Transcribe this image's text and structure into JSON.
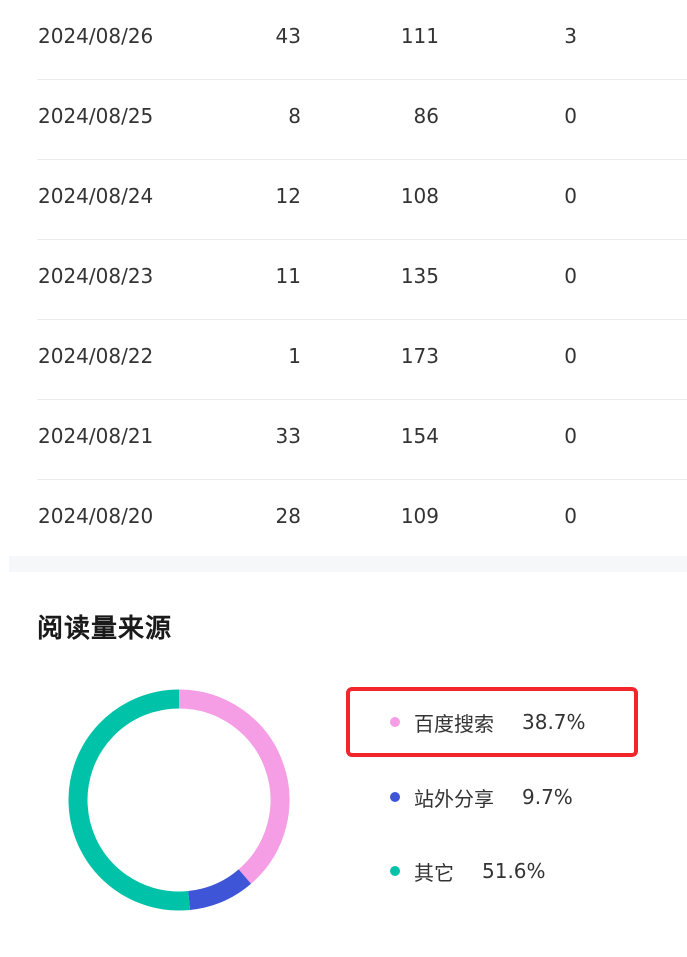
{
  "table": {
    "rows": [
      {
        "date": "2024/08/26",
        "a": "43",
        "b": "111",
        "c": "3"
      },
      {
        "date": "2024/08/25",
        "a": "8",
        "b": "86",
        "c": "0"
      },
      {
        "date": "2024/08/24",
        "a": "12",
        "b": "108",
        "c": "0"
      },
      {
        "date": "2024/08/23",
        "a": "11",
        "b": "135",
        "c": "0"
      },
      {
        "date": "2024/08/22",
        "a": "1",
        "b": "173",
        "c": "0"
      },
      {
        "date": "2024/08/21",
        "a": "33",
        "b": "154",
        "c": "0"
      },
      {
        "date": "2024/08/20",
        "a": "28",
        "b": "109",
        "c": "0"
      }
    ]
  },
  "sources": {
    "title": "阅读量来源",
    "items": [
      {
        "label": "百度搜索",
        "percent": "38.7%",
        "value": 38.7,
        "color": "#f59ee6",
        "highlighted": true
      },
      {
        "label": "站外分享",
        "percent": "9.7%",
        "value": 9.7,
        "color": "#3d55d6",
        "highlighted": false
      },
      {
        "label": "其它",
        "percent": "51.6%",
        "value": 51.6,
        "color": "#00c2a8",
        "highlighted": false
      }
    ]
  },
  "chart_data": {
    "type": "pie",
    "title": "阅读量来源",
    "categories": [
      "百度搜索",
      "站外分享",
      "其它"
    ],
    "values": [
      38.7,
      9.7,
      51.6
    ],
    "colors": [
      "#f59ee6",
      "#3d55d6",
      "#00c2a8"
    ],
    "legend": "right"
  }
}
